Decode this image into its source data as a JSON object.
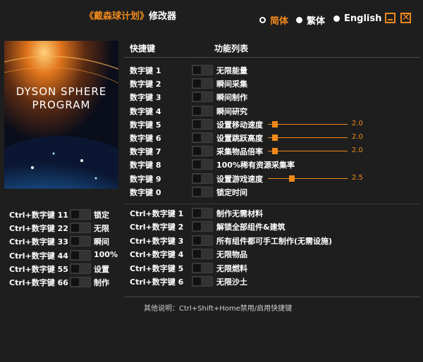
{
  "window": {
    "title_game": "《戴森球计划》",
    "title_suffix": "修改器",
    "languages": [
      {
        "label": "简体",
        "active": true
      },
      {
        "label": "繁体",
        "active": false
      },
      {
        "label": "English",
        "active": false
      }
    ],
    "minimize_icon": "minimize-icon",
    "close_icon": "close-icon",
    "accent_color": "#f08a1c"
  },
  "cover": {
    "line1": "DYSON SPHERE",
    "line2": "PROGRAM"
  },
  "table": {
    "header_key": "快捷键",
    "header_feature": "功能列表"
  },
  "numpad_rows": [
    {
      "key": "数字键 1",
      "feature": "无限能量"
    },
    {
      "key": "数字键 2",
      "feature": "瞬间采集"
    },
    {
      "key": "数字键 3",
      "feature": "瞬间制作"
    },
    {
      "key": "数字键 4",
      "feature": "瞬间研究"
    },
    {
      "key": "数字键 5",
      "feature": "设置移动速度",
      "slider": {
        "value": "2.0",
        "fraction": 0.0
      }
    },
    {
      "key": "数字键 6",
      "feature": "设置跳跃高度",
      "slider": {
        "value": "2.0",
        "fraction": 0.0
      }
    },
    {
      "key": "数字键 7",
      "feature": "采集物品倍率",
      "slider": {
        "value": "2.0",
        "fraction": 0.0
      }
    },
    {
      "key": "数字键 8",
      "feature": "100%稀有资源采集率"
    },
    {
      "key": "数字键 9",
      "feature": "设置游戏速度",
      "slider": {
        "value": "2.5",
        "fraction": 0.3
      }
    },
    {
      "key": "数字键 0",
      "feature": "锁定时间"
    }
  ],
  "ctrl_rows": [
    {
      "key": "Ctrl+数字键 1",
      "feature": "制作无需材料"
    },
    {
      "key": "Ctrl+数字键 2",
      "feature": "解锁全部组件&建筑"
    },
    {
      "key": "Ctrl+数字键 3",
      "feature": "所有组件都可手工制作(无需设施)"
    },
    {
      "key": "Ctrl+数字键 4",
      "feature": "无限物品"
    },
    {
      "key": "Ctrl+数字键 5",
      "feature": "无限燃料"
    },
    {
      "key": "Ctrl+数字键 6",
      "feature": "无限沙土"
    }
  ],
  "left_rows": [
    {
      "key": "Ctrl+数字键 11",
      "feature": "锁定"
    },
    {
      "key": "Ctrl+数字键 22",
      "feature": "无限"
    },
    {
      "key": "Ctrl+数字键 33",
      "feature": "瞬间"
    },
    {
      "key": "Ctrl+数字键 44",
      "feature": "100%"
    },
    {
      "key": "Ctrl+数字键 55",
      "feature": "设置"
    },
    {
      "key": "Ctrl+数字键 66",
      "feature": "制作"
    }
  ],
  "footer": {
    "note": "其他说明：Ctrl+Shift+Home禁用/启用快捷键"
  }
}
